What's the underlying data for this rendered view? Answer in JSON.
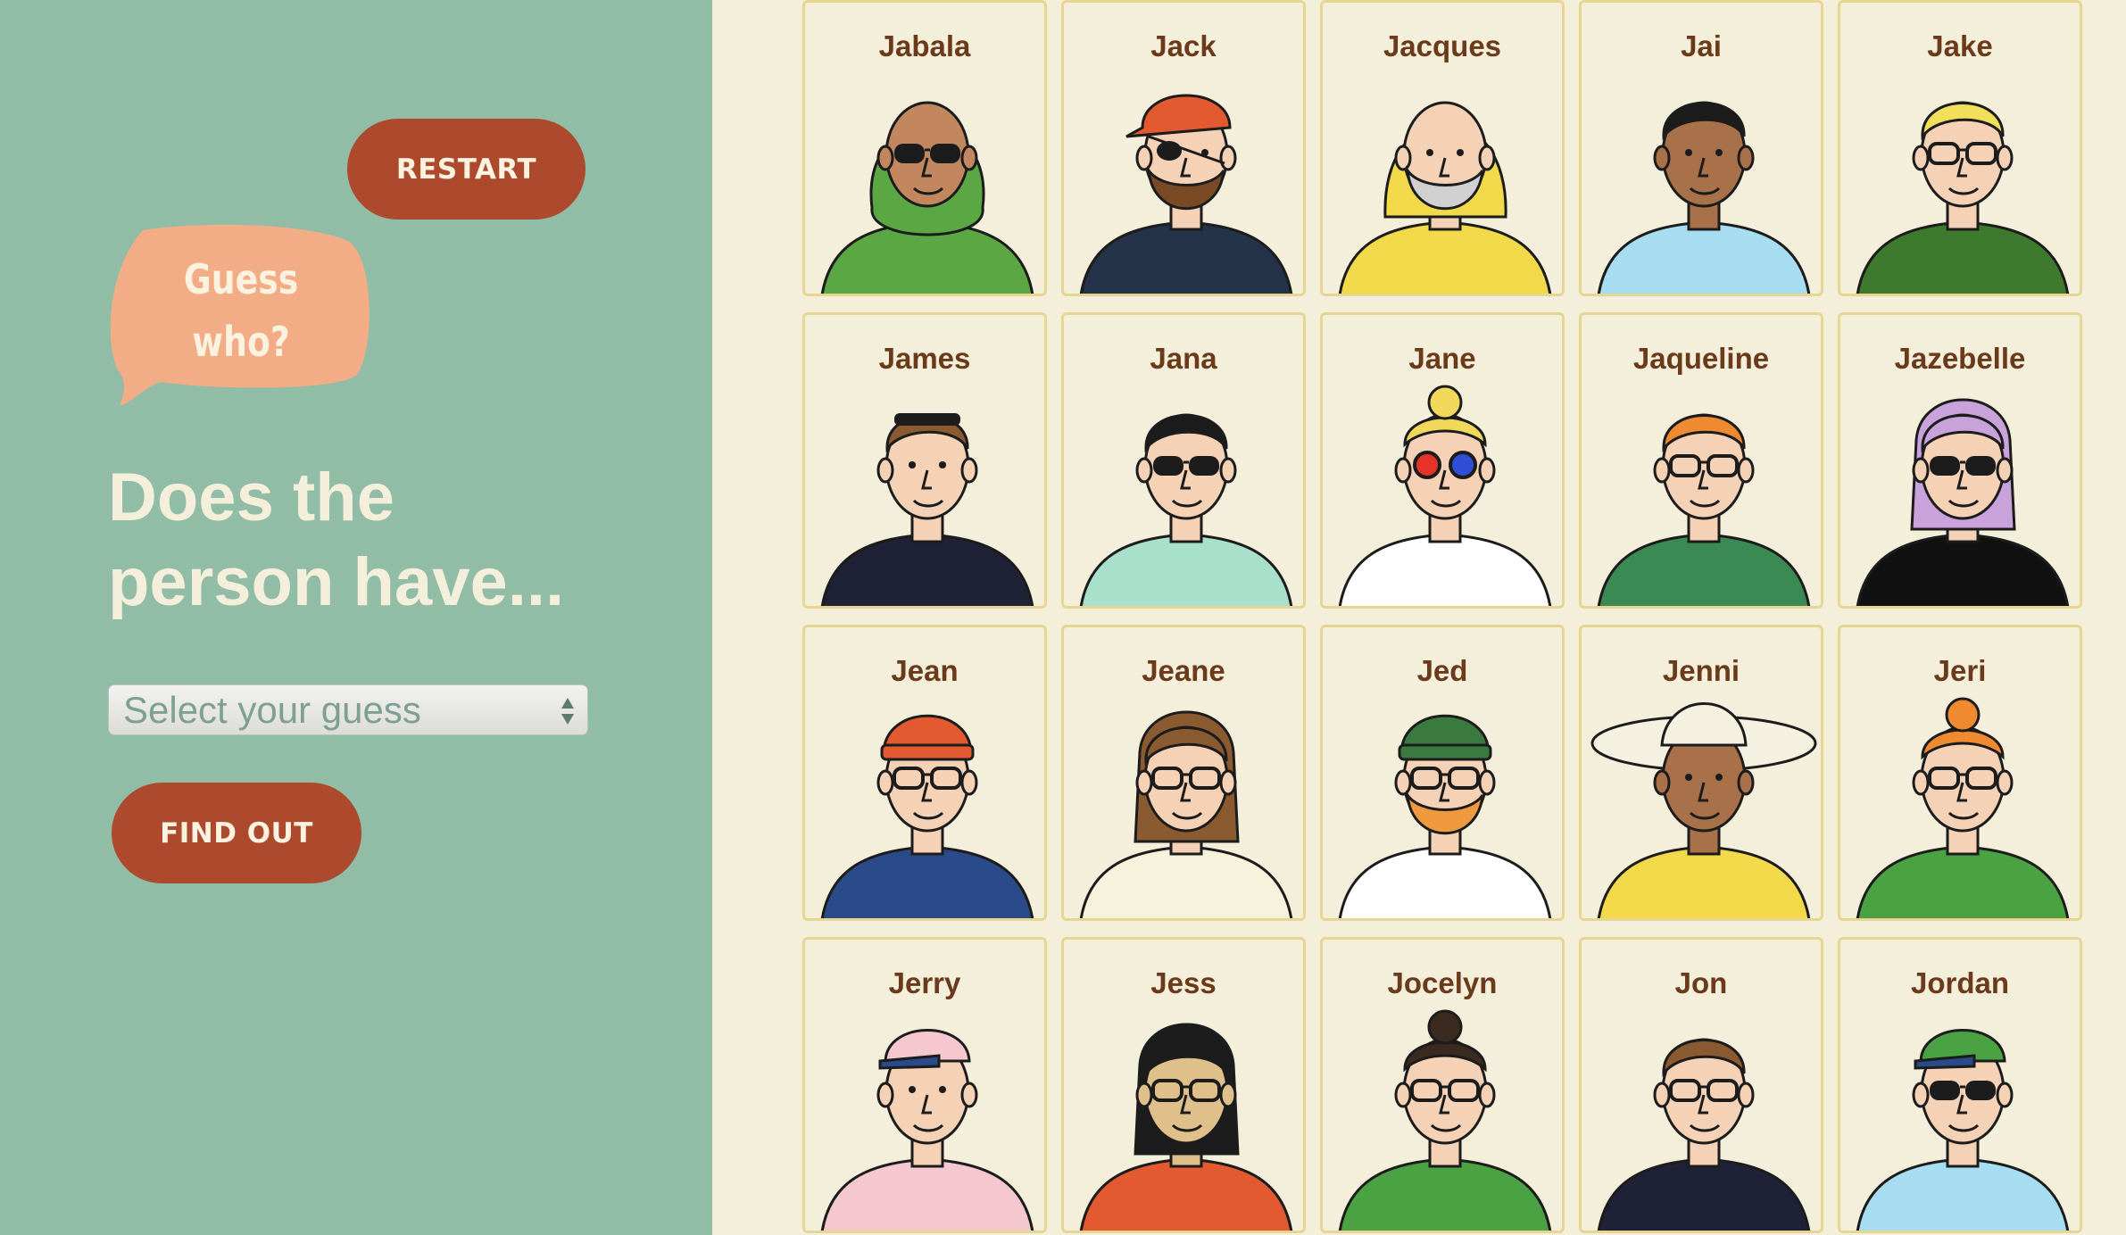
{
  "sidebar": {
    "restart_label": "RESTART",
    "bubble_line1": "Guess",
    "bubble_line2": "who?",
    "question_line1": "Does the",
    "question_line2": "person have...",
    "select_placeholder": "Select your guess",
    "find_out_label": "FIND OUT"
  },
  "colors": {
    "sidebar_bg": "#91bca6",
    "board_bg": "#f3efdb",
    "button": "#ad4a2e",
    "bubble": "#f2ad86",
    "card_border": "#e8d592",
    "name_text": "#6b3a1a"
  },
  "characters": [
    {
      "name": "Jabala",
      "skin": "#c2875e",
      "hair": "#5aa743",
      "hat": "hijab",
      "glasses": "sunglasses",
      "shirt": "#5aa743"
    },
    {
      "name": "Jack",
      "skin": "#f5d2b5",
      "hair": "#7a4a25",
      "hat": "bandana-red",
      "glasses": "eyepatch",
      "shirt": "#24324a"
    },
    {
      "name": "Jacques",
      "skin": "#f5d2b5",
      "hair": "#d0d0d0",
      "hat": "yellow-hood",
      "glasses": "none",
      "shirt": "#f1d94a"
    },
    {
      "name": "Jai",
      "skin": "#a9714a",
      "hair": "#1c1c1c",
      "hat": "none",
      "glasses": "none",
      "shirt": "#a6ddf0"
    },
    {
      "name": "Jake",
      "skin": "#f5d2b5",
      "hair": "#f1df5a",
      "hat": "none",
      "glasses": "glasses",
      "shirt": "#3e7a2e"
    },
    {
      "name": "James",
      "skin": "#f5d2b5",
      "hair": "#8a5a30",
      "hat": "none",
      "glasses": "sunglasses-head",
      "shirt": "#1f2236"
    },
    {
      "name": "Jana",
      "skin": "#f5d2b5",
      "hair": "#1c1c1c",
      "hat": "none",
      "glasses": "sunglasses",
      "shirt": "#a9e0cb"
    },
    {
      "name": "Jane",
      "skin": "#f5d2b5",
      "hair": "#f2d85a",
      "hat": "bun",
      "glasses": "3d",
      "shirt": "#ffffff"
    },
    {
      "name": "Jaqueline",
      "skin": "#f5d2b5",
      "hair": "#f08a30",
      "hat": "none",
      "glasses": "glasses",
      "shirt": "#3b8a54"
    },
    {
      "name": "Jazebelle",
      "skin": "#f5d2b5",
      "hair": "#c9a2dc",
      "hat": "none",
      "glasses": "round-dark",
      "shirt": "#111111"
    },
    {
      "name": "Jean",
      "skin": "#f5d2b5",
      "hair": "#e45a30",
      "hat": "beanie-red",
      "glasses": "glasses",
      "shirt": "#2b4a8a"
    },
    {
      "name": "Jeane",
      "skin": "#f5d2b5",
      "hair": "#8a5a30",
      "hat": "none",
      "glasses": "glasses",
      "shirt": "#f7f2dc"
    },
    {
      "name": "Jed",
      "skin": "#f5d2b5",
      "hair": "#f09a40",
      "hat": "beanie-green",
      "glasses": "glasses",
      "shirt": "#ffffff"
    },
    {
      "name": "Jenni",
      "skin": "#a9714a",
      "hair": "#ffffff",
      "hat": "sunhat",
      "glasses": "none",
      "shirt": "#f1d94a"
    },
    {
      "name": "Jeri",
      "skin": "#f5d2b5",
      "hair": "#f08a30",
      "hat": "bun",
      "glasses": "round",
      "shirt": "#4aa243"
    },
    {
      "name": "Jerry",
      "skin": "#f5d2b5",
      "hair": "#f5d2b5",
      "hat": "cap-pink",
      "glasses": "none",
      "shirt": "#f5c8d0"
    },
    {
      "name": "Jess",
      "skin": "#e0c08a",
      "hair": "#1c1c1c",
      "hat": "none",
      "glasses": "round",
      "shirt": "#e45a30"
    },
    {
      "name": "Jocelyn",
      "skin": "#f5d2b5",
      "hair": "#3a2a20",
      "hat": "bun",
      "glasses": "glasses",
      "shirt": "#4aa243"
    },
    {
      "name": "Jon",
      "skin": "#f5d2b5",
      "hair": "#8a5a30",
      "hat": "none",
      "glasses": "glasses",
      "shirt": "#1f2236"
    },
    {
      "name": "Jordan",
      "skin": "#f5d2b5",
      "hair": "#f2d85a",
      "hat": "cap-green",
      "glasses": "sunglasses",
      "shirt": "#a6ddf0"
    }
  ]
}
